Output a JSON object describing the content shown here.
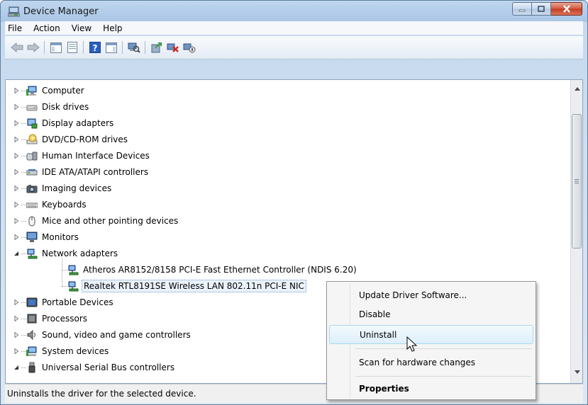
{
  "window": {
    "title": "Device Manager"
  },
  "menubar": {
    "items": [
      "File",
      "Action",
      "View",
      "Help"
    ]
  },
  "toolbar": {
    "buttons": [
      {
        "icon": "back-arrow-icon"
      },
      {
        "icon": "forward-arrow-icon"
      },
      {
        "icon": "show-hide-console-tree-icon"
      },
      {
        "icon": "properties-sheet-icon"
      },
      {
        "icon": "help-icon"
      },
      {
        "icon": "action-pane-icon"
      },
      {
        "icon": "scan-hardware-changes-icon"
      },
      {
        "icon": "update-driver-icon"
      },
      {
        "icon": "uninstall-device-icon"
      },
      {
        "icon": "disable-device-icon"
      }
    ]
  },
  "tree": {
    "items": [
      {
        "label": "Computer",
        "icon": "computer-icon",
        "expanded": false,
        "level": 0
      },
      {
        "label": "Disk drives",
        "icon": "disk-drive-icon",
        "expanded": false,
        "level": 0
      },
      {
        "label": "Display adapters",
        "icon": "display-adapter-icon",
        "expanded": false,
        "level": 0
      },
      {
        "label": "DVD/CD-ROM drives",
        "icon": "dvd-drive-icon",
        "expanded": false,
        "level": 0
      },
      {
        "label": "Human Interface Devices",
        "icon": "hid-icon",
        "expanded": false,
        "level": 0
      },
      {
        "label": "IDE ATA/ATAPI controllers",
        "icon": "ide-controller-icon",
        "expanded": false,
        "level": 0
      },
      {
        "label": "Imaging devices",
        "icon": "imaging-device-icon",
        "expanded": false,
        "level": 0
      },
      {
        "label": "Keyboards",
        "icon": "keyboard-icon",
        "expanded": false,
        "level": 0
      },
      {
        "label": "Mice and other pointing devices",
        "icon": "mouse-icon",
        "expanded": false,
        "level": 0
      },
      {
        "label": "Monitors",
        "icon": "monitor-icon",
        "expanded": false,
        "level": 0
      },
      {
        "label": "Network adapters",
        "icon": "network-adapter-icon",
        "expanded": true,
        "level": 0
      },
      {
        "label": "Atheros AR8152/8158 PCI-E Fast Ethernet Controller (NDIS 6.20)",
        "icon": "network-adapter-icon",
        "level": 1
      },
      {
        "label": "Realtek RTL8191SE Wireless LAN 802.11n PCI-E NIC",
        "icon": "network-adapter-icon",
        "level": 1,
        "selected": true
      },
      {
        "label": "Portable Devices",
        "icon": "portable-device-icon",
        "expanded": false,
        "level": 0
      },
      {
        "label": "Processors",
        "icon": "processor-icon",
        "expanded": false,
        "level": 0
      },
      {
        "label": "Sound, video and game controllers",
        "icon": "sound-icon",
        "expanded": false,
        "level": 0
      },
      {
        "label": "System devices",
        "icon": "system-device-icon",
        "expanded": false,
        "level": 0
      },
      {
        "label": "Universal Serial Bus controllers",
        "icon": "usb-icon",
        "expanded": true,
        "level": 0
      }
    ]
  },
  "context_menu": {
    "items": [
      {
        "label": "Update Driver Software...",
        "highlight": false,
        "bold": false
      },
      {
        "label": "Disable",
        "highlight": false,
        "bold": false
      },
      {
        "label": "Uninstall",
        "highlight": true,
        "bold": false
      },
      {
        "label": "Scan for hardware changes",
        "highlight": false,
        "bold": false
      },
      {
        "label": "Properties",
        "highlight": false,
        "bold": true
      }
    ]
  },
  "statusbar": {
    "text": "Uninstalls the driver for the selected device."
  }
}
